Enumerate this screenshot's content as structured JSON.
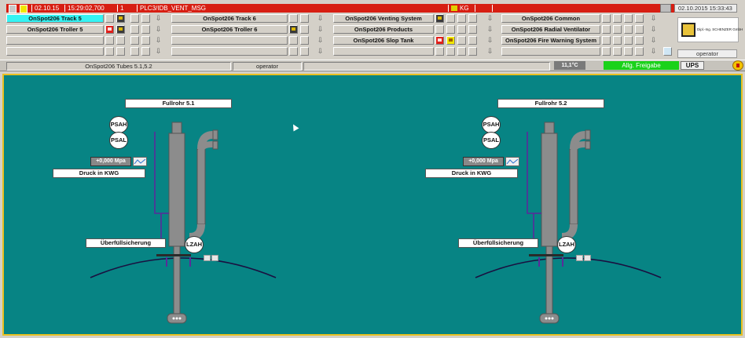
{
  "alarm_bar": {
    "date": "02.10.15",
    "time": "15:29:02,700",
    "count": "1",
    "message": "PLC3/IDB_VENT_MSG",
    "tag": "KG",
    "clock": "02.10.2015 15:33:43"
  },
  "nav": {
    "rows": [
      {
        "left": "OnSpot206 Track 5",
        "mid": "OnSpot206 Track 6",
        "right": "OnSpot206 Venting System",
        "far": "OnSpot206 Common"
      },
      {
        "left": "OnSpot206 Troller 5",
        "mid": "OnSpot206 Troller 6",
        "right": "OnSpot206 Products",
        "far": "OnSpot206 Radial Ventilator"
      },
      {
        "left": "",
        "mid": "",
        "right": "OnSpot206 Slop Tank",
        "far": "OnSpot206 Fire Warning System"
      },
      {
        "left": "",
        "mid": "",
        "right": "",
        "far": ""
      }
    ]
  },
  "logo": {
    "text": "Dipl.-Ing. SCHENZER GmbH"
  },
  "user_right": "operator",
  "status": {
    "screen_title": "OnSpot206 Tubes 5.1,5.2",
    "user": "operator",
    "temperature": "11,1°C",
    "release": "Allg. Freigabe",
    "ups": "UPS"
  },
  "tubes": [
    {
      "title": "Fullrohr 5.1",
      "psah": "PSAH",
      "psal": "PSAL",
      "pressure": "+0,000 Mpa",
      "pressure_label": "Druck in KWG",
      "overflow": "Überfüllsicherung",
      "lzah": "LZAH"
    },
    {
      "title": "Fullrohr 5.2",
      "psah": "PSAH",
      "psal": "PSAL",
      "pressure": "+0,000 Mpa",
      "pressure_label": "Druck in KWG",
      "overflow": "Überfüllsicherung",
      "lzah": "LZAH"
    }
  ],
  "colors": {
    "canvas": "#078484",
    "border": "#e8c020",
    "alarm": "#d71e12",
    "active_tab": "#35f3f3",
    "release": "#1ad21a"
  }
}
